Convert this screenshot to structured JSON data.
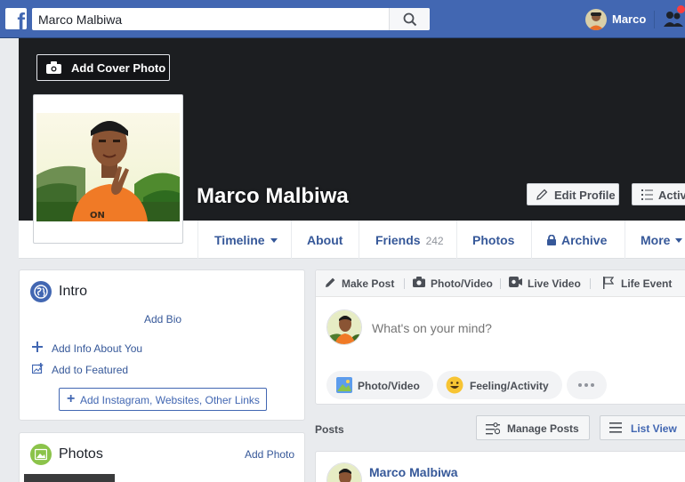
{
  "topbar": {
    "logo": "f",
    "search_value": "Marco Malbiwa",
    "user_name": "Marco"
  },
  "cover": {
    "add_cover_label": "Add Cover Photo",
    "profile_name": "Marco Malbiwa",
    "edit_profile_label": "Edit Profile",
    "activity_label": "Activity Log"
  },
  "tabs": {
    "timeline": "Timeline",
    "about": "About",
    "friends": "Friends",
    "friends_count": "242",
    "photos": "Photos",
    "archive": "Archive",
    "more": "More"
  },
  "intro": {
    "title": "Intro",
    "add_bio": "Add Bio",
    "add_info": "Add Info About You",
    "add_featured": "Add to Featured",
    "add_links": "Add Instagram, Websites, Other Links"
  },
  "photos_card": {
    "title": "Photos",
    "add_photo": "Add Photo"
  },
  "composer": {
    "make_post": "Make Post",
    "photo_video_tab": "Photo/Video",
    "live_video": "Live Video",
    "life_event": "Life Event",
    "placeholder": "What's on your mind?",
    "pill_photo_video": "Photo/Video",
    "pill_feeling": "Feeling/Activity"
  },
  "posts": {
    "label": "Posts",
    "manage_posts": "Manage Posts",
    "list_view": "List View",
    "first_author": "Marco Malbiwa"
  },
  "colors": {
    "brand_blue": "#4267b2",
    "link_blue": "#365899",
    "cover_dark": "#1c1e21",
    "notif_red": "#fa3e3e"
  }
}
